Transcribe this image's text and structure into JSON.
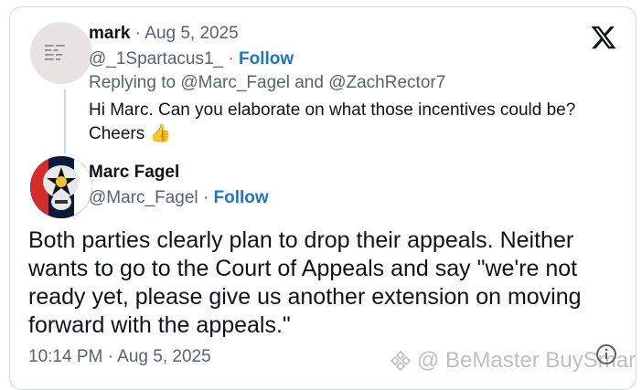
{
  "reply": {
    "name": "mark",
    "separator": "·",
    "date": "Aug 5, 2025",
    "handle": "@_1Spartacus1_",
    "follow_label": "Follow",
    "replying_prefix": "Replying to",
    "replying_user1": "@Marc_Fagel",
    "replying_and": "and",
    "replying_user2": "@ZachRector7",
    "text": "Hi Marc. Can you elaborate on what those incentives could be? Cheers",
    "emoji": "👍"
  },
  "main": {
    "name": "Marc Fagel",
    "handle": "@Marc_Fagel",
    "separator": "·",
    "follow_label": "Follow",
    "text": "Both parties clearly plan to drop their appeals. Neither wants to go to the Court of Appeals and say \"we're not ready yet, please give us another extension on moving forward with the appeals.\"",
    "timestamp": "10:14 PM · Aug 5, 2025"
  },
  "watermark": {
    "text": "@ BeMaster BuySmart"
  },
  "icons": {
    "brand": "x-logo-icon",
    "info": "info-icon",
    "watermark": "binance-diamond-icon"
  },
  "colors": {
    "follow": "#1d77c6",
    "secondary_text": "#536471",
    "border": "#cfd9de"
  }
}
